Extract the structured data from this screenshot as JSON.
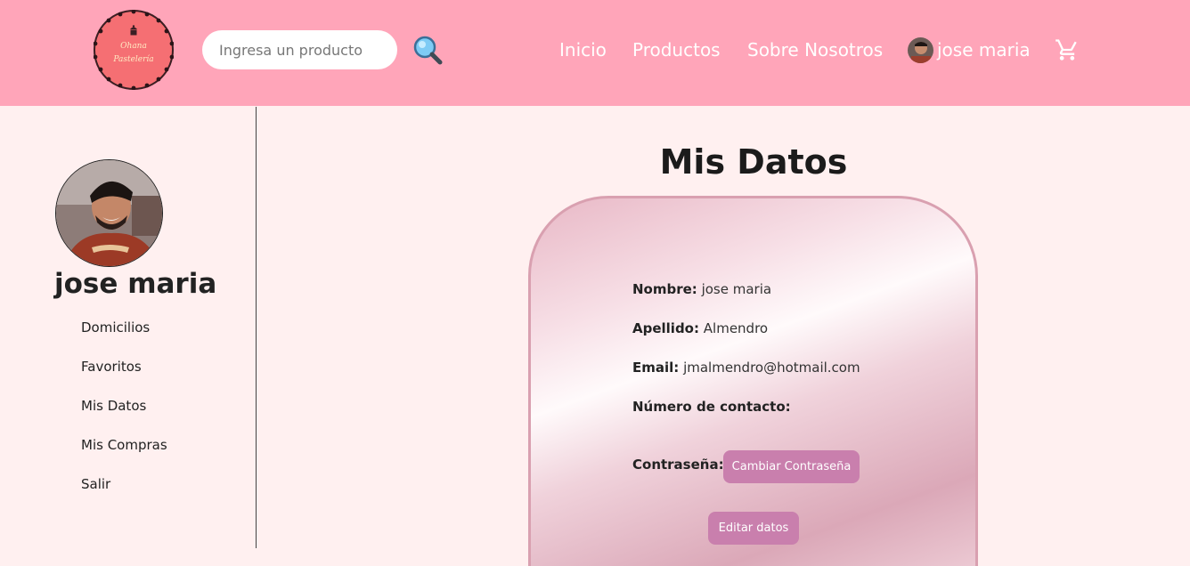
{
  "header": {
    "logo_text_line1": "Ohana",
    "logo_text_line2": "Pastelería",
    "search_placeholder": "Ingresa un producto",
    "nav": {
      "home": "Inicio",
      "products": "Productos",
      "about": "Sobre Nosotros",
      "user": "jose maria"
    },
    "icons": {
      "search": "magnifier-icon",
      "cart": "cart-icon"
    }
  },
  "sidebar": {
    "user_name": "jose maria",
    "items": [
      {
        "label": "Domicilios"
      },
      {
        "label": "Favoritos"
      },
      {
        "label": "Mis Datos"
      },
      {
        "label": "Mis Compras"
      },
      {
        "label": "Salir"
      }
    ]
  },
  "main": {
    "title": "Mis Datos",
    "fields": {
      "name_label": "Nombre:",
      "name_value": "jose maria",
      "lastname_label": "Apellido:",
      "lastname_value": "Almendro",
      "email_label": "Email:",
      "email_value": "jmalmendro@hotmail.com",
      "phone_label": "Número de contacto:",
      "phone_value": "",
      "password_label": "Contraseña:"
    },
    "change_password_button": "Cambiar Contraseña",
    "edit_button": "Editar datos"
  },
  "colors": {
    "header_bg": "#ffa5b9",
    "page_bg": "#fff0f0",
    "logo_bg": "#f56f73",
    "button_bg": "#c97fad"
  }
}
